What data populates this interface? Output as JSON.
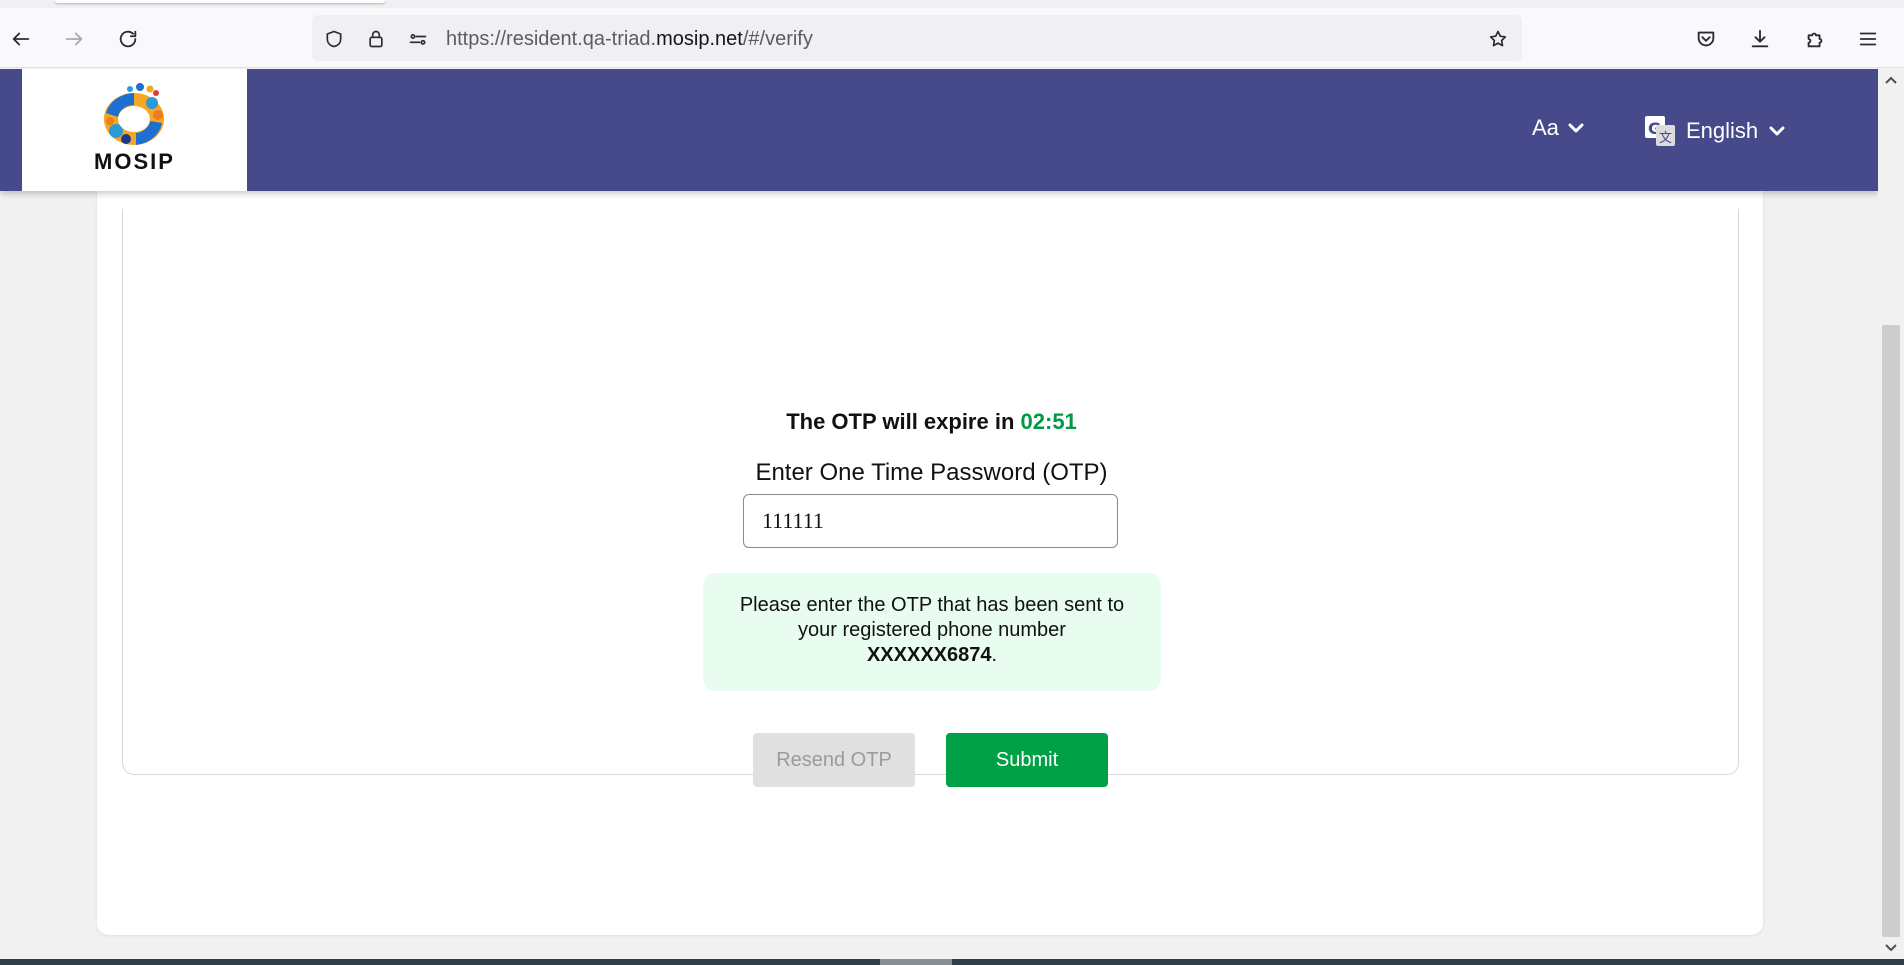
{
  "browser": {
    "url_prefix": "https://resident.qa-triad.",
    "url_host": "mosip.net",
    "url_suffix": "/#/verify",
    "icons": {
      "back": "arrow-left-icon",
      "forward": "arrow-right-icon",
      "reload": "reload-icon",
      "tracking": "shield-icon",
      "lock": "lock-icon",
      "permissions": "permissions-icon",
      "bookmark": "star-icon",
      "pocket": "pocket-icon",
      "downloads": "download-icon",
      "extensions": "puzzle-icon",
      "menu": "hamburger-menu-icon"
    }
  },
  "header": {
    "logo_text": "MOSIP",
    "font_size_label": "Aa",
    "language": "English",
    "background_color": "#46498a"
  },
  "otp": {
    "timer_prefix": "The OTP will expire in ",
    "timer_value": "02:51",
    "label": "Enter One Time Password (OTP)",
    "input_value": "111111",
    "info_line1": "Please enter the OTP that has been sent to",
    "info_line2": "your registered phone number",
    "phone_masked": "XXXXXX6874",
    "info_suffix": ".",
    "resend_label": "Resend OTP",
    "submit_label": "Submit",
    "timer_color": "#009944",
    "submit_color": "#00a046",
    "info_bg_color": "#e8fcf0"
  }
}
